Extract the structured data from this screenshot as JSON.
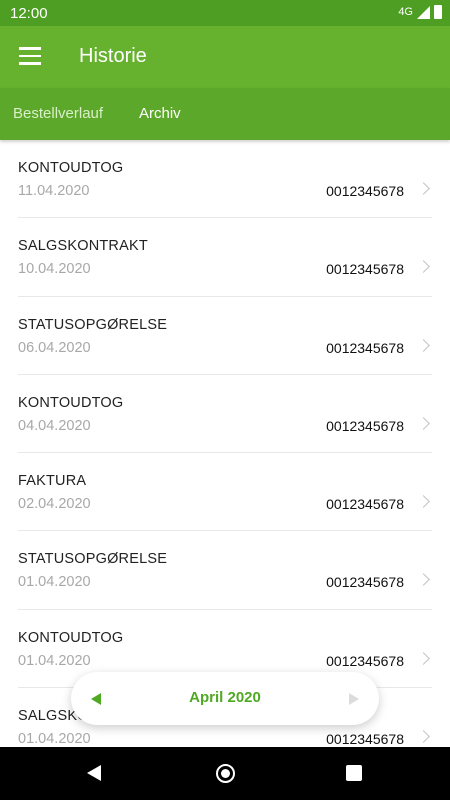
{
  "status_bar": {
    "time": "12:00",
    "network": "4G"
  },
  "app_bar": {
    "title": "Historie",
    "menu_icon": "hamburger-menu-icon"
  },
  "tabs": [
    {
      "label": "Bestellverlauf",
      "selected": false
    },
    {
      "label": "Archiv",
      "selected": true
    }
  ],
  "documents": [
    {
      "type": "KONTOUDTOG",
      "date": "11.04.2020",
      "number": "0012345678"
    },
    {
      "type": "SALGSKONTRAKT",
      "date": "10.04.2020",
      "number": "0012345678"
    },
    {
      "type": "STATUSOPGØRELSE",
      "date": "06.04.2020",
      "number": "0012345678"
    },
    {
      "type": "KONTOUDTOG",
      "date": "04.04.2020",
      "number": "0012345678"
    },
    {
      "type": "FAKTURA",
      "date": "02.04.2020",
      "number": "0012345678"
    },
    {
      "type": "STATUSOPGØRELSE",
      "date": "01.04.2020",
      "number": "0012345678"
    },
    {
      "type": "KONTOUDTOG",
      "date": "01.04.2020",
      "number": "0012345678"
    },
    {
      "type": "SALGSKONTRAKT",
      "date": "01.04.2020",
      "number": "0012345678"
    }
  ],
  "month_picker": {
    "label": "April 2020",
    "prev_enabled": true,
    "next_enabled": false
  },
  "colors": {
    "primary": "#66b22e",
    "status_bar": "#4e9e23",
    "accent": "#4fa923"
  }
}
